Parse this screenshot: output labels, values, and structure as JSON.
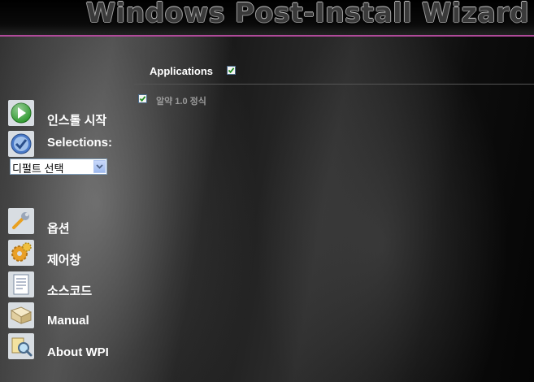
{
  "header": {
    "title": "Windows Post-Install Wizard"
  },
  "applications": {
    "label": "Applications",
    "checked": true,
    "items": [
      {
        "label": "알약 1.0 정식",
        "checked": true
      }
    ]
  },
  "sidebar": {
    "install": {
      "label": "인스톨 시작",
      "icon": "play-icon"
    },
    "selections": {
      "label": "Selections:",
      "icon": "checkmark-icon"
    },
    "select": {
      "value": "디펄트 선택"
    },
    "options": {
      "label": "옵션",
      "icon": "wrench-icon"
    },
    "control": {
      "label": "제어창",
      "icon": "gear-icon"
    },
    "source": {
      "label": "소스코드",
      "icon": "document-icon"
    },
    "manual": {
      "label": "Manual",
      "icon": "book-icon"
    },
    "about": {
      "label": "About WPI",
      "icon": "magnifier-icon"
    }
  },
  "colors": {
    "accent": "#b04a9a",
    "check": "#2e8b57"
  }
}
